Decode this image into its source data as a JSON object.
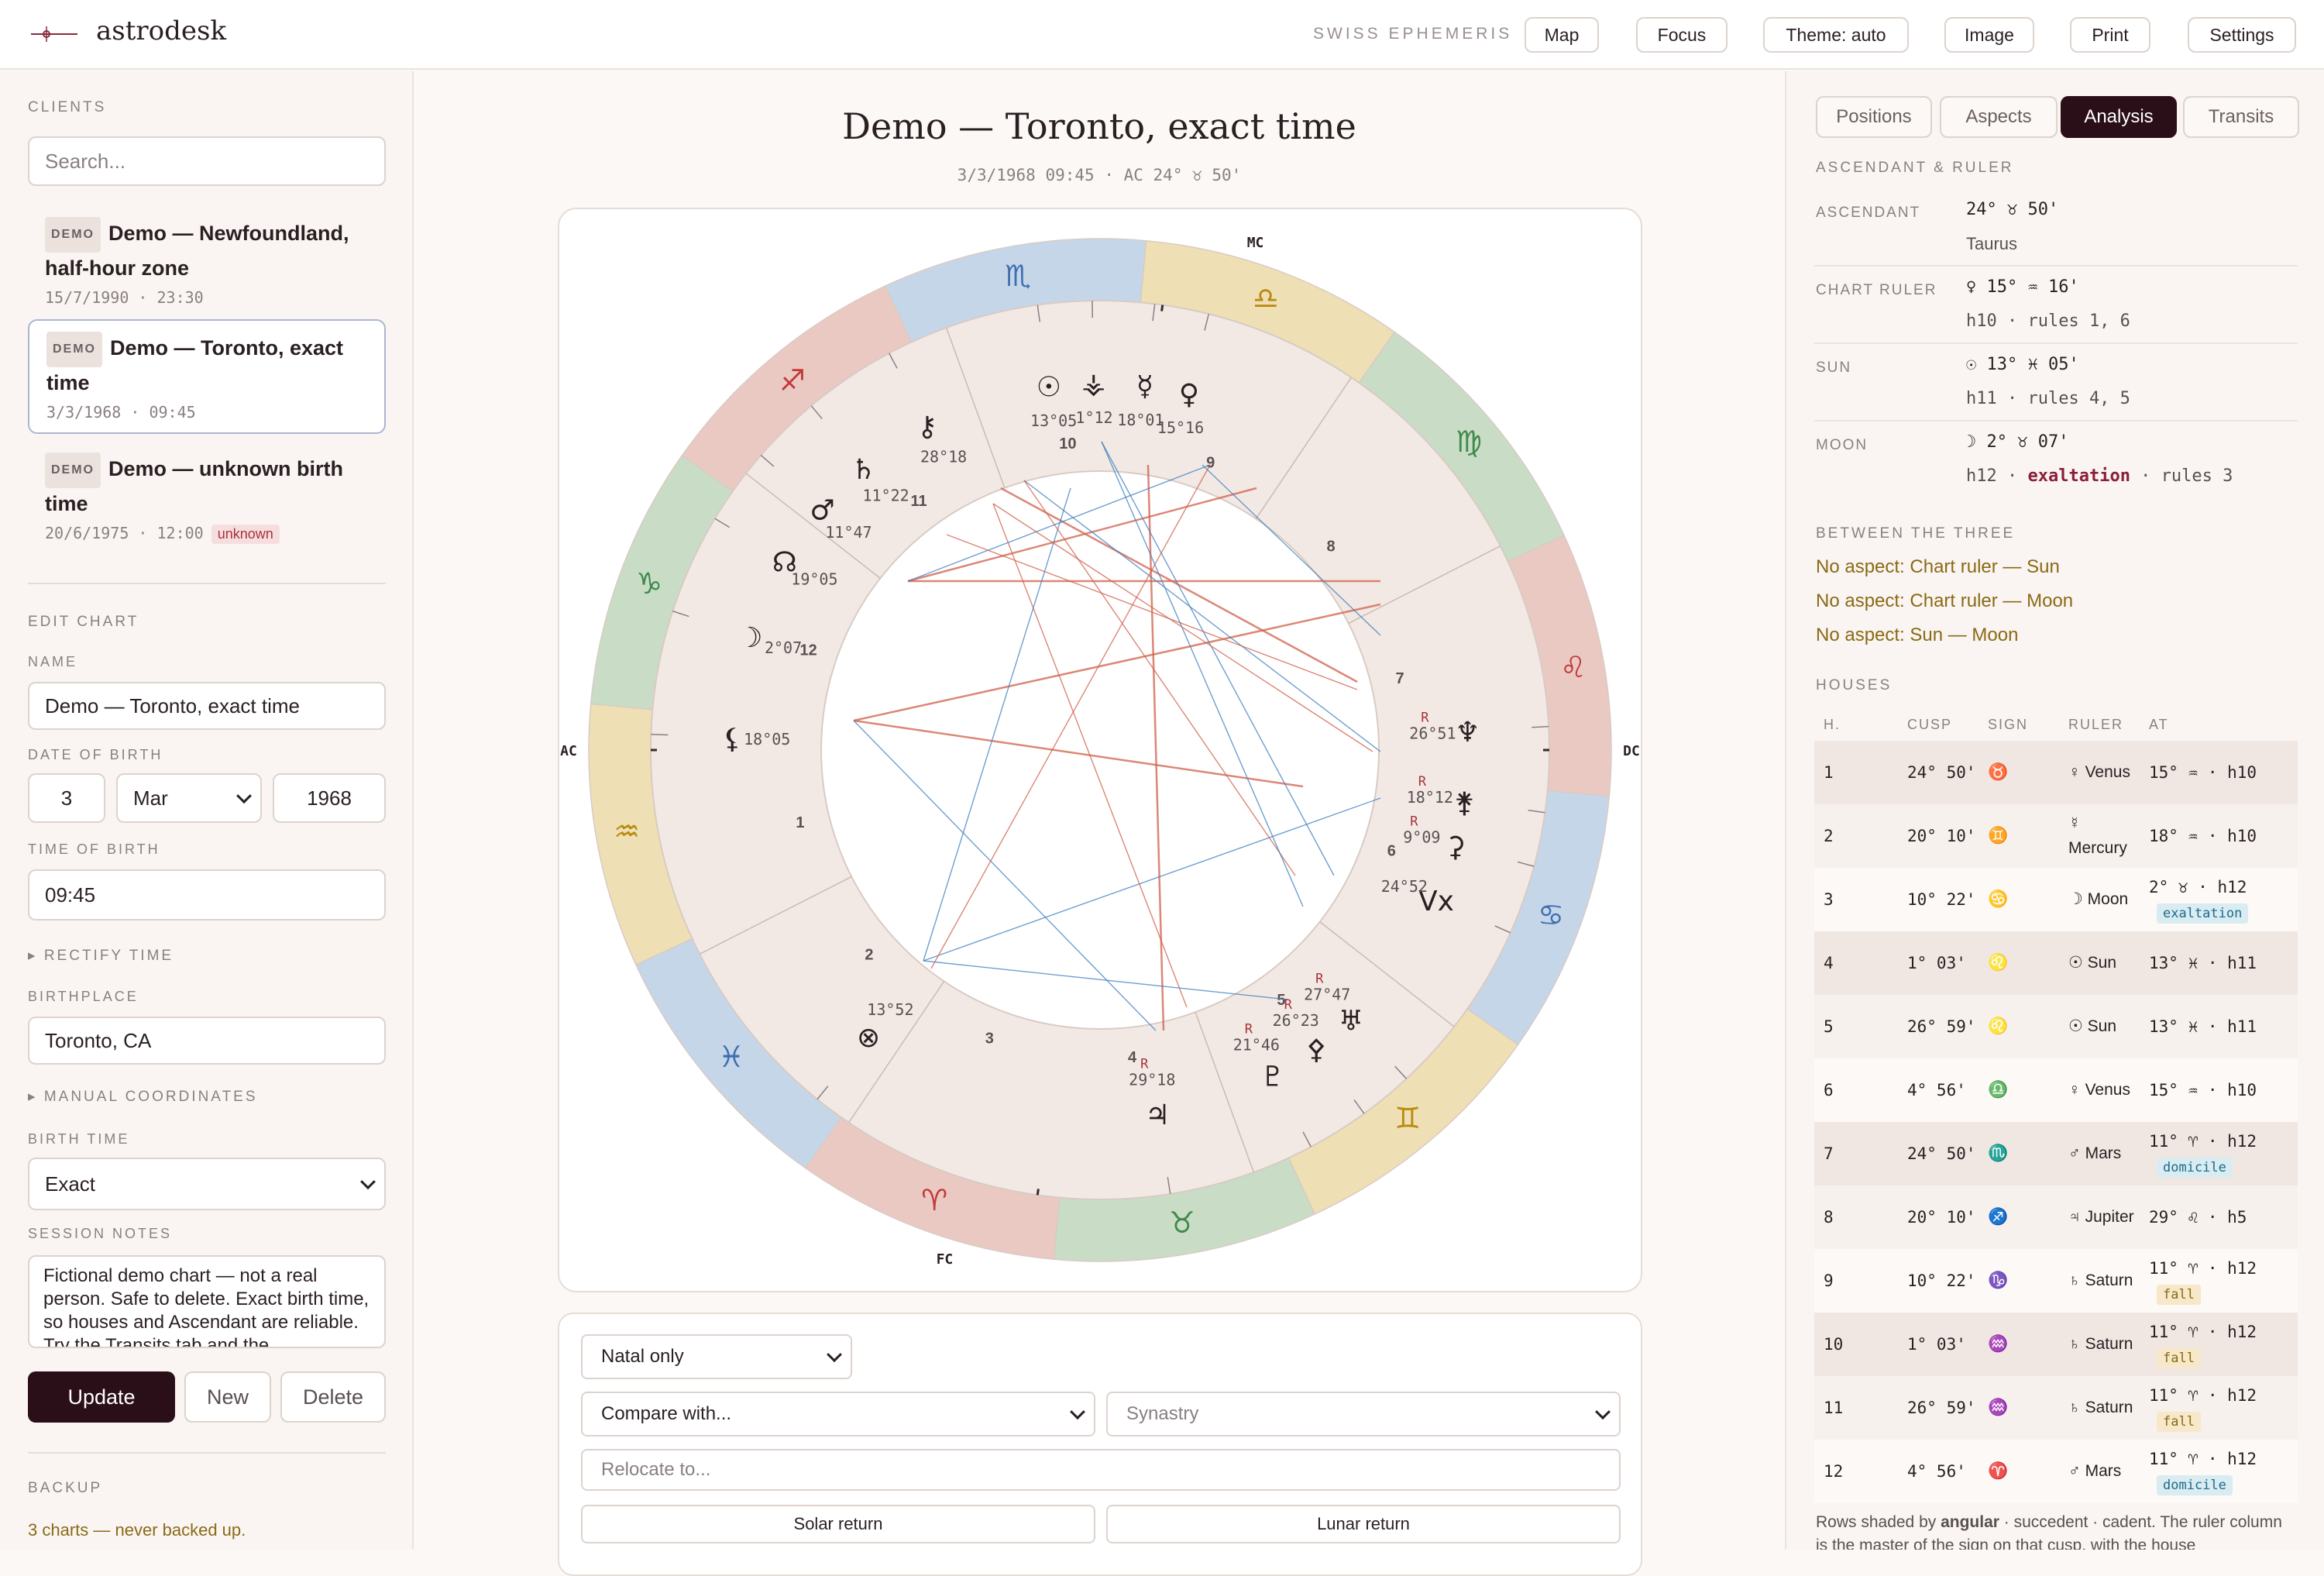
{
  "app": {
    "name": "astrodesk",
    "ephemeris": "SWISS EPHEMERIS"
  },
  "toolbar": {
    "map": "Map",
    "focus": "Focus",
    "theme": "Theme: auto",
    "image": "Image",
    "print": "Print",
    "settings": "Settings"
  },
  "clients": {
    "label": "CLIENTS",
    "search_placeholder": "Search...",
    "items": [
      {
        "badge": "DEMO",
        "name": "Demo — Newfoundland, half-hour zone",
        "meta": "15/7/1990 · 23:30",
        "status": ""
      },
      {
        "badge": "DEMO",
        "name": "Demo — Toronto, exact time",
        "meta": "3/3/1968 · 09:45",
        "status": ""
      },
      {
        "badge": "DEMO",
        "name": "Demo — unknown birth time",
        "meta": "20/6/1975 · 12:00",
        "status": "unknown"
      }
    ]
  },
  "edit": {
    "label": "EDIT CHART",
    "name_label": "NAME",
    "name_value": "Demo — Toronto, exact time",
    "dob_label": "DATE OF BIRTH",
    "day": "3",
    "month": "Mar",
    "year": "1968",
    "tob_label": "TIME OF BIRTH",
    "time": "09:45",
    "rectify": "RECTIFY TIME",
    "place_label": "BIRTHPLACE",
    "place": "Toronto, CA",
    "manual": "MANUAL COORDINATES",
    "bt_label": "BIRTH TIME",
    "bt_value": "Exact",
    "notes_label": "SESSION NOTES",
    "notes": "Fictional demo chart — not a real person. Safe to delete. Exact birth time, so houses and Ascendant are reliable. Try the Transits tab and the",
    "update": "Update",
    "new": "New",
    "delete": "Delete",
    "backup_label": "BACKUP",
    "backup_text": "3 charts — never backed up."
  },
  "center": {
    "title": "Demo — Toronto, exact time",
    "subtitle": "3/3/1968 09:45 · AC 24° ♉ 50'",
    "axes": {
      "ac": "AC",
      "dc": "DC",
      "mc": "MC",
      "fc": "FC"
    },
    "signs": [
      "♈",
      "♉",
      "♊",
      "♋",
      "♌",
      "♍",
      "♎",
      "♏",
      "♐",
      "♑",
      "♒",
      "♓"
    ],
    "houses": [
      "1",
      "2",
      "3",
      "4",
      "5",
      "6",
      "7",
      "8",
      "9",
      "10",
      "11",
      "12"
    ],
    "planets": [
      {
        "glyph": "☉",
        "deg": "13°05",
        "r": ""
      },
      {
        "glyph": "⚶",
        "deg": "1°12",
        "r": ""
      },
      {
        "glyph": "☿",
        "deg": "18°01",
        "r": ""
      },
      {
        "glyph": "♀",
        "deg": "15°16",
        "r": ""
      },
      {
        "glyph": "⚷",
        "deg": "28°18",
        "r": ""
      },
      {
        "glyph": "♄",
        "deg": "11°22",
        "r": ""
      },
      {
        "glyph": "♂",
        "deg": "11°47",
        "r": ""
      },
      {
        "glyph": "☊",
        "deg": "19°05",
        "r": ""
      },
      {
        "glyph": "☽",
        "deg": "2°07",
        "r": ""
      },
      {
        "glyph": "⚸",
        "deg": "18°05",
        "r": ""
      },
      {
        "glyph": "♆",
        "deg": "26°51",
        "r": "R"
      },
      {
        "glyph": "⚵",
        "deg": "18°12",
        "r": "R"
      },
      {
        "glyph": "⚳",
        "deg": "9°09",
        "r": "R"
      },
      {
        "glyph": "Vx",
        "deg": "24°52",
        "r": ""
      },
      {
        "glyph": "♅",
        "deg": "27°47",
        "r": "R"
      },
      {
        "glyph": "⚴",
        "deg": "26°23",
        "r": "R"
      },
      {
        "glyph": "♇",
        "deg": "21°46",
        "r": "R"
      },
      {
        "glyph": "♃",
        "deg": "29°18",
        "r": "R"
      },
      {
        "glyph": "⊗",
        "deg": "13°52",
        "r": ""
      }
    ],
    "mode": "Natal only",
    "compare": "Compare with...",
    "synastry": "Synastry",
    "relocate_placeholder": "Relocate to...",
    "solar": "Solar return",
    "lunar": "Lunar return"
  },
  "right": {
    "tabs": [
      "Positions",
      "Aspects",
      "Analysis",
      "Transits"
    ],
    "active_tab": "Analysis",
    "asc_label": "ASCENDANT & RULER",
    "rows": [
      {
        "key": "ASCENDANT",
        "val": "24° ♉ 50'",
        "sub": "Taurus",
        "sub_strong": "",
        "sub_after": ""
      },
      {
        "key": "CHART RULER",
        "val": "♀ 15° ♒ 16'",
        "sub": "h10 · rules 1, 6",
        "sub_strong": "",
        "sub_after": ""
      },
      {
        "key": "SUN",
        "val": "☉ 13° ♓ 05'",
        "sub": "h11 · rules 4, 5",
        "sub_strong": "",
        "sub_after": ""
      },
      {
        "key": "MOON",
        "val": "☽ 2° ♉ 07'",
        "sub": "h12 · ",
        "sub_strong": "exaltation",
        "sub_after": " · rules 3"
      }
    ],
    "between_label": "BETWEEN THE THREE",
    "between": [
      "No aspect: Chart ruler — Sun",
      "No aspect: Chart ruler — Moon",
      "No aspect: Sun — Moon"
    ],
    "houses_label": "HOUSES",
    "houses_cols": [
      "H.",
      "CUSP",
      "SIGN",
      "RULER",
      "AT"
    ],
    "houses": [
      {
        "h": "1",
        "cusp": "24° 50'",
        "sign": "♉",
        "ruler": "♀ Venus",
        "at": "15° ♒ · h10",
        "dig": "",
        "kind": "angular"
      },
      {
        "h": "2",
        "cusp": "20° 10'",
        "sign": "♊",
        "ruler": "☿ Mercury",
        "at": "18° ♒ · h10",
        "dig": "",
        "kind": "succedent"
      },
      {
        "h": "3",
        "cusp": "10° 22'",
        "sign": "♋",
        "ruler": "☽ Moon",
        "at": "2° ♉ · h12",
        "dig": "exaltation",
        "kind": "cadent"
      },
      {
        "h": "4",
        "cusp": "1° 03'",
        "sign": "♌",
        "ruler": "☉ Sun",
        "at": "13° ♓ · h11",
        "dig": "",
        "kind": "angular"
      },
      {
        "h": "5",
        "cusp": "26° 59'",
        "sign": "♌",
        "ruler": "☉ Sun",
        "at": "13° ♓ · h11",
        "dig": "",
        "kind": "succedent"
      },
      {
        "h": "6",
        "cusp": "4° 56'",
        "sign": "♎",
        "ruler": "♀ Venus",
        "at": "15° ♒ · h10",
        "dig": "",
        "kind": "cadent"
      },
      {
        "h": "7",
        "cusp": "24° 50'",
        "sign": "♏",
        "ruler": "♂ Mars",
        "at": "11° ♈ · h12",
        "dig": "domicile",
        "kind": "angular"
      },
      {
        "h": "8",
        "cusp": "20° 10'",
        "sign": "♐",
        "ruler": "♃ Jupiter",
        "at": "29° ♌ · h5",
        "dig": "",
        "kind": "succedent"
      },
      {
        "h": "9",
        "cusp": "10° 22'",
        "sign": "♑",
        "ruler": "♄ Saturn",
        "at": "11° ♈ · h12",
        "dig": "fall",
        "kind": "cadent"
      },
      {
        "h": "10",
        "cusp": "1° 03'",
        "sign": "♒",
        "ruler": "♄ Saturn",
        "at": "11° ♈ · h12",
        "dig": "fall",
        "kind": "angular"
      },
      {
        "h": "11",
        "cusp": "26° 59'",
        "sign": "♒",
        "ruler": "♄ Saturn",
        "at": "11° ♈ · h12",
        "dig": "fall",
        "kind": "succedent"
      },
      {
        "h": "12",
        "cusp": "4° 56'",
        "sign": "♈",
        "ruler": "♂ Mars",
        "at": "11° ♈ · h12",
        "dig": "domicile",
        "kind": "cadent"
      }
    ],
    "footnote_a": "Rows shaded by ",
    "footnote_strong": "angular",
    "footnote_b": " · succedent · cadent. The ruler column is the master of the sign on that cusp, with the house"
  },
  "colors": {
    "accent": "#2b0f18",
    "fire": "#ebc9c3",
    "earth": "#c9dcc6",
    "air": "#efdfb4",
    "water": "#c6d6e9",
    "red_line": "#d0604a",
    "blue_line": "#3f7fbf"
  }
}
